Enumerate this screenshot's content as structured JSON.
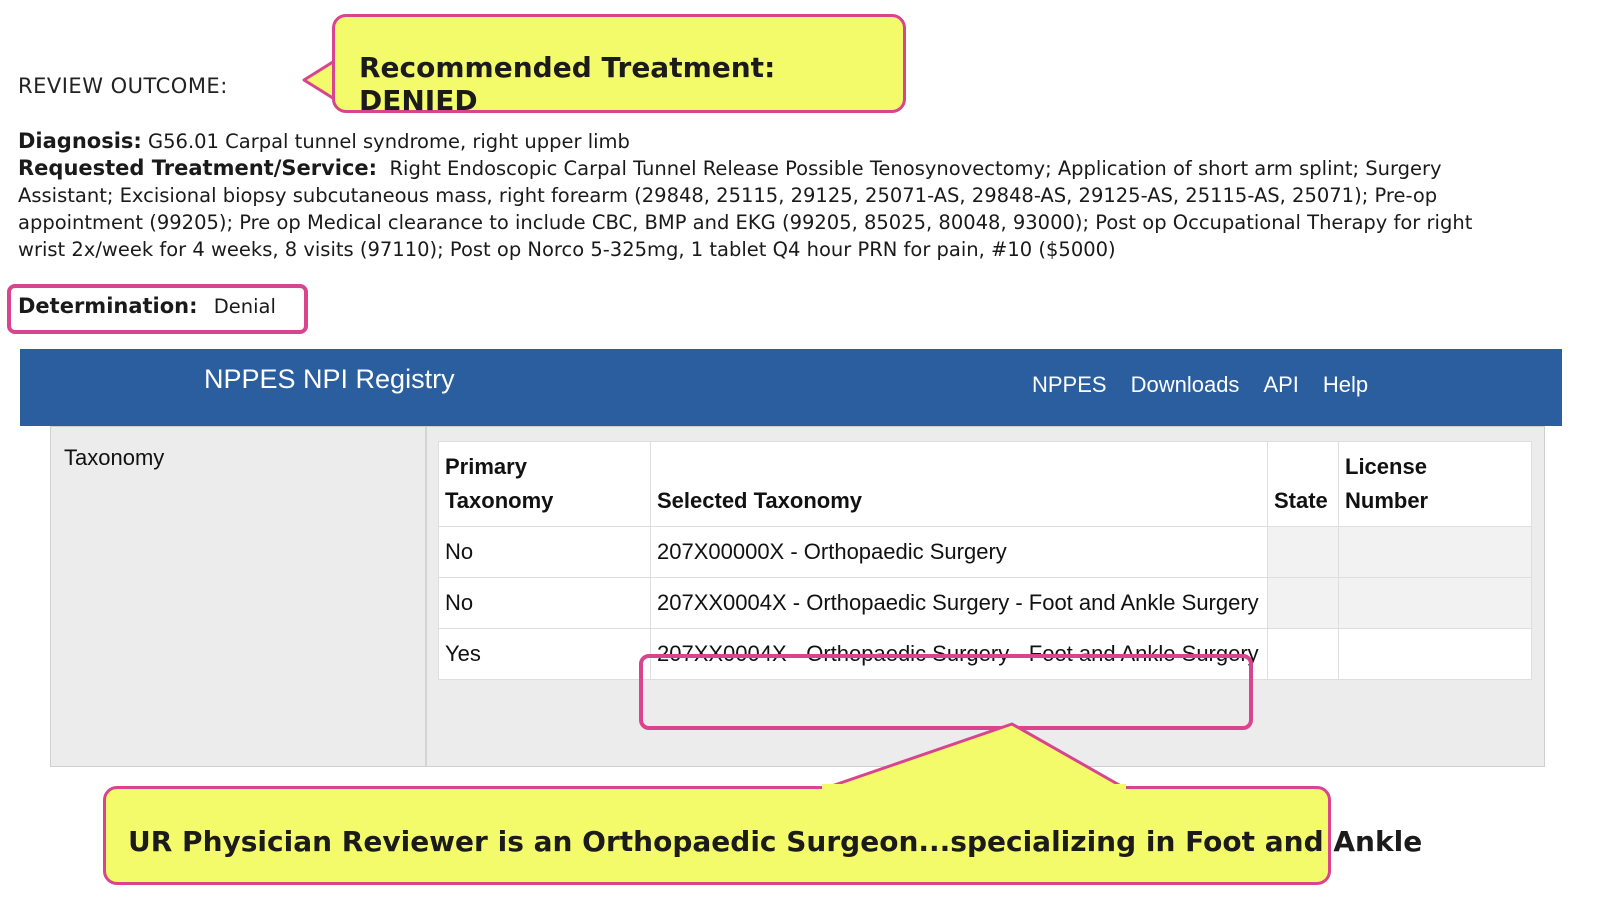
{
  "review": {
    "outcome_label": "REVIEW OUTCOME:",
    "diagnosis_label": "Diagnosis:",
    "diagnosis_value": "G56.01 Carpal tunnel syndrome, right upper limb",
    "requested_label": "Requested Treatment/Service:",
    "requested_value": "Right Endoscopic Carpal Tunnel Release Possible Tenosynovectomy; Application of short arm splint; Surgery Assistant; Excisional biopsy subcutaneous mass, right forearm (29848, 25115, 29125, 25071-AS, 29848-AS, 29125-AS, 25115-AS, 25071); Pre-op appointment (99205); Pre op Medical clearance to include CBC, BMP and EKG (99205, 85025, 80048, 93000); Post op Occupational Therapy for right wrist 2x/week for 4 weeks, 8 visits (97110); Post op Norco 5-325mg, 1 tablet Q4 hour PRN for pain, #10 ($5000)",
    "determination_label": "Determination:",
    "determination_value": "Denial"
  },
  "callouts": {
    "top": "Recommended Treatment: DENIED",
    "bottom": "UR Physician Reviewer is an Orthopaedic Surgeon...specializing in Foot and Ankle"
  },
  "nppes": {
    "brand": "NPPES NPI Registry",
    "nav": [
      "NPPES",
      "Downloads",
      "API",
      "Help"
    ]
  },
  "taxonomy": {
    "section_label": "Taxonomy",
    "headers": {
      "primary_line1": "Primary",
      "primary_line2": "Taxonomy",
      "selected": "Selected Taxonomy",
      "state": "State",
      "license_line1": "License",
      "license_line2": "Number"
    },
    "rows": [
      {
        "primary": "No",
        "selected": "207X00000X - Orthopaedic Surgery",
        "state": "",
        "license": ""
      },
      {
        "primary": "No",
        "selected": "207XX0004X - Orthopaedic Surgery - Foot and Ankle Surgery",
        "state": "",
        "license": ""
      },
      {
        "primary": "Yes",
        "selected": "207XX0004X - Orthopaedic Surgery - Foot and Ankle Surgery",
        "state": "",
        "license": ""
      }
    ]
  },
  "colors": {
    "callout_fill": "#f4fb6a",
    "callout_border": "#d9448f",
    "nppes_header": "#2a5e9f"
  }
}
